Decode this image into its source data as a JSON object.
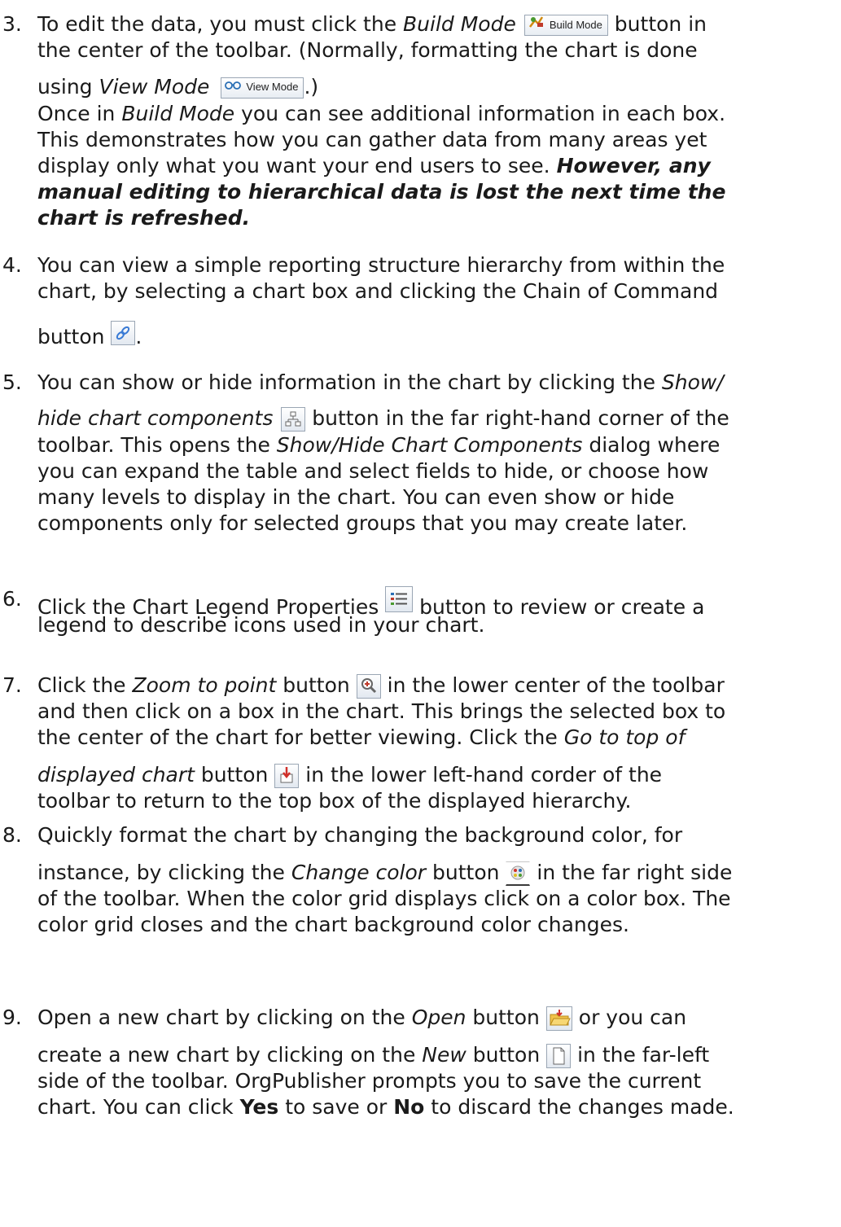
{
  "steps": [
    {
      "number": "3.",
      "line1_a": "To edit the data, you must click the ",
      "line1_em": "Build Mode",
      "line1_b": " button in",
      "build_mode_button_label": "Build Mode",
      "line2": "the center of the toolbar. (Normally, formatting the chart is done",
      "line3_a": "using ",
      "line3_em": "View Mode",
      "view_mode_button_label": "View Mode",
      "line3_b": ".)",
      "line4_a": "Once in ",
      "line4_em": "Build Mode",
      "line4_b": " you can see additional information in each box.",
      "line5": "This demonstrates how you can gather data from many areas yet",
      "line6_a": "display only what you want your end users to see. ",
      "line6_bi": "However, any",
      "line7": "manual editing to hierarchical data is lost the next time the",
      "line8": "chart is refreshed."
    },
    {
      "number": "4.",
      "line1": "You can view a simple reporting structure hierarchy from within the",
      "line2": "chart, by selecting a chart box and clicking the Chain of Command",
      "line3_a": "button ",
      "line3_b": "."
    },
    {
      "number": "5.",
      "line1_a": "You can show or hide information in the chart by clicking the ",
      "line1_em": "Show/",
      "line2_em": "hide chart components",
      "line2_b": " button in the far right-hand corner of the",
      "line3_a": "toolbar. This opens the ",
      "line3_em": "Show/Hide Chart Components",
      "line3_b": " dialog where",
      "line4": "you can expand the table and select fields to hide, or choose how",
      "line5": "many levels to display in the chart. You can even show or hide",
      "line6": "components only for selected groups that you may create later."
    },
    {
      "number": "6.",
      "line1_a": "Click the Chart Legend Properties ",
      "line1_b": " button to review or create a",
      "line2": "legend to describe icons used in your chart."
    },
    {
      "number": "7.",
      "line1_a": "Click the ",
      "line1_em": "Zoom to point",
      "line1_b": " button ",
      "line1_c": " in the lower center of the toolbar",
      "line2": "and then click on a box in the chart. This brings the selected box to",
      "line3_a": "the center of the chart for better viewing. Click the ",
      "line3_em": "Go to top of",
      "line4_em": "displayed chart",
      "line4_a": " button ",
      "line4_b": " in the lower left-hand corder of the",
      "line5": "toolbar to return to the top box of the displayed hierarchy."
    },
    {
      "number": "8.",
      "line1": "Quickly format the chart by changing the background color, for",
      "line2_a": "instance, by clicking the ",
      "line2_em": "Change color",
      "line2_b": " button ",
      "line2_c": " in the far right side",
      "line3": "of the toolbar. When the color grid displays click on a color box. The",
      "line4": "color grid closes and the chart background color changes."
    },
    {
      "number": "9.",
      "line1_a": "Open a new chart by clicking on the ",
      "line1_em": "Open",
      "line1_b": " button ",
      "line1_c": " or you can",
      "line2_a": "create a new chart by clicking on the ",
      "line2_em": "New",
      "line2_b": " button ",
      "line2_c": " in the far-left",
      "line3": "side of the toolbar. OrgPublisher prompts you to save the current",
      "line4_a": "chart. You can click ",
      "line4_yes": "Yes",
      "line4_b": " to save or ",
      "line4_no": "No",
      "line4_c": " to discard the changes made."
    }
  ]
}
